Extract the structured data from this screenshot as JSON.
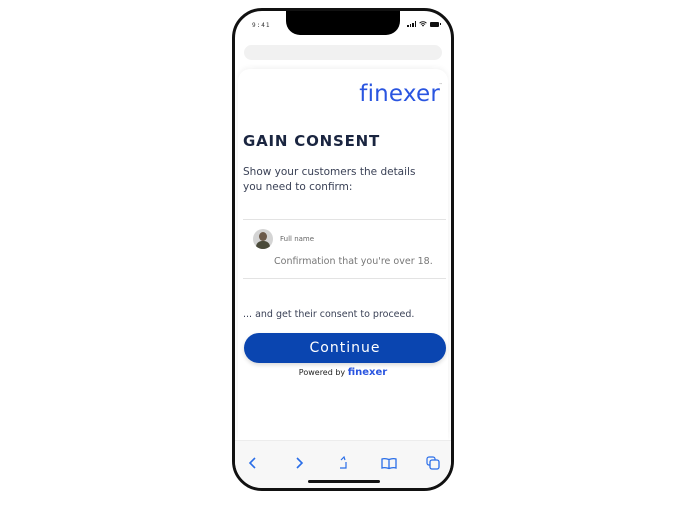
{
  "status_bar": {
    "time": "9:41"
  },
  "brand": {
    "logo": "finexer",
    "accent_color": "#2a55e0",
    "button_color": "#0a45b0"
  },
  "page": {
    "title": "GAIN CONSENT",
    "description": "Show your customers the details you need to confirm:",
    "field": {
      "label": "Full name",
      "value": "Confirmation that you're over 18."
    },
    "consent_text": "... and get their consent to proceed.",
    "continue_label": "Continue",
    "powered_by": "Powered by",
    "powered_brand": "finexer"
  },
  "toolbar": {
    "icons": [
      "back-icon",
      "forward-icon",
      "share-icon",
      "bookmarks-icon",
      "tabs-icon"
    ]
  }
}
